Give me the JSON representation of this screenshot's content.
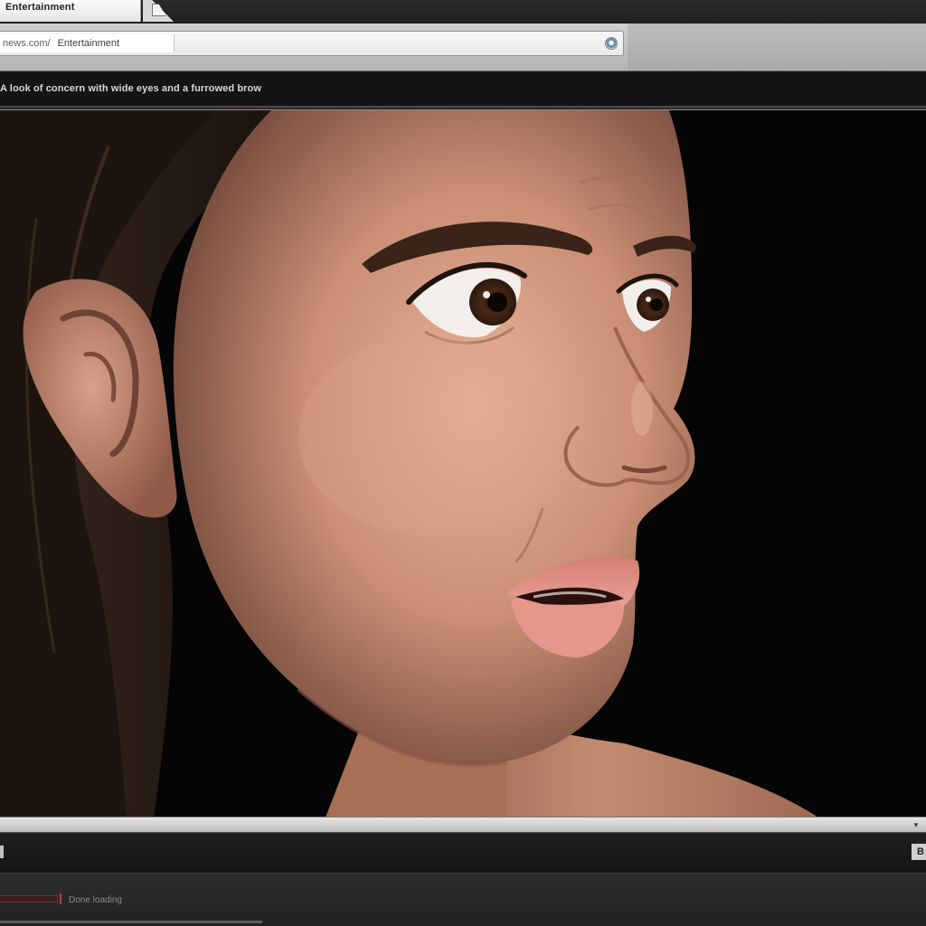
{
  "browser": {
    "tab": {
      "title": "Entertainment"
    },
    "address_bar": {
      "prefix": "news.com/",
      "site": "Entertainment"
    }
  },
  "content": {
    "caption": "A look of concern with wide eyes and a furrowed brow",
    "photo_alt": "woman with a worried expression"
  },
  "status": {
    "text": "Done loading"
  },
  "controls": {
    "right_label": "B",
    "scroll_arrow": "▾"
  },
  "colors": {
    "chrome_dark": "#141415",
    "chrome_light": "#cfcfcf",
    "background": "#050505",
    "accent_red": "#b04040"
  }
}
